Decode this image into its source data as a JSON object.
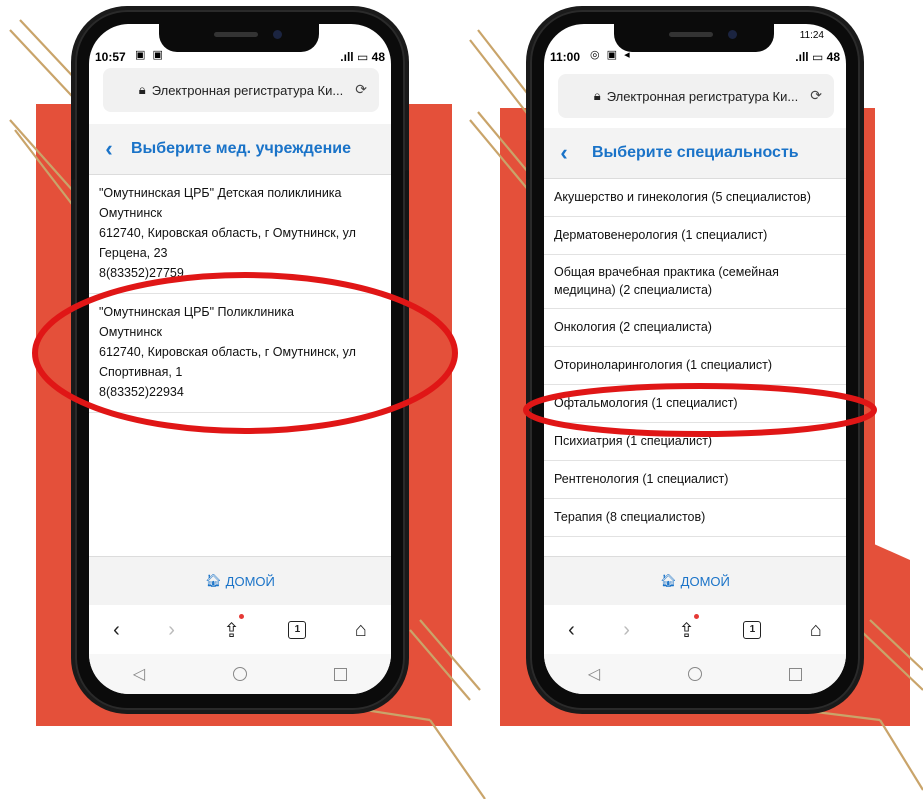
{
  "left_phone": {
    "status_time": "10:57",
    "status_right": "48",
    "url_text": "Электронная регистратура Ки...",
    "header_title": "Выберите мед. учреждение",
    "clinics": [
      {
        "name": "\"Омутнинская ЦРБ\" Детская поликлиника",
        "city": "Омутнинск",
        "address": "612740, Кировская область, г Омутнинск, ул Герцена, 23",
        "phone": "8(83352)27759"
      },
      {
        "name": "\"Омутнинская ЦРБ\" Поликлиника",
        "city": "Омутнинск",
        "address": "612740, Кировская область, г Омутнинск, ул Спортивная, 1",
        "phone": "8(83352)22934"
      }
    ],
    "home_label": "ДОМОЙ",
    "tab_count": "1"
  },
  "right_phone": {
    "status_time": "11:00",
    "status_top_right": "11:24",
    "status_right": "48",
    "url_text": "Электронная регистратура Ки...",
    "header_title": "Выберите специальность",
    "specialties": [
      "Акушерство и гинекология (5 специалистов)",
      "Дерматовенерология (1 специалист)",
      "Общая врачебная практика (семейная медицина) (2 специалиста)",
      "Онкология (2 специалиста)",
      "Оториноларингология (1 специалист)",
      "Офтальмология (1 специалист)",
      "Психиатрия (1 специалист)",
      "Рентгенология (1 специалист)",
      "Терапия (8 специалистов)"
    ],
    "home_label": "ДОМОЙ",
    "tab_count": "1"
  },
  "colors": {
    "accent": "#1a73c8",
    "decor_red": "#e4503a",
    "highlight_ring": "#e01616",
    "gold_lines": "#c9a46a"
  },
  "icons": {
    "back": "chevron-left-icon",
    "lock": "lock-icon",
    "reload": "reload-icon",
    "home": "home-icon",
    "share": "share-icon",
    "tabs": "tabs-icon",
    "browser_home": "house-icon"
  }
}
